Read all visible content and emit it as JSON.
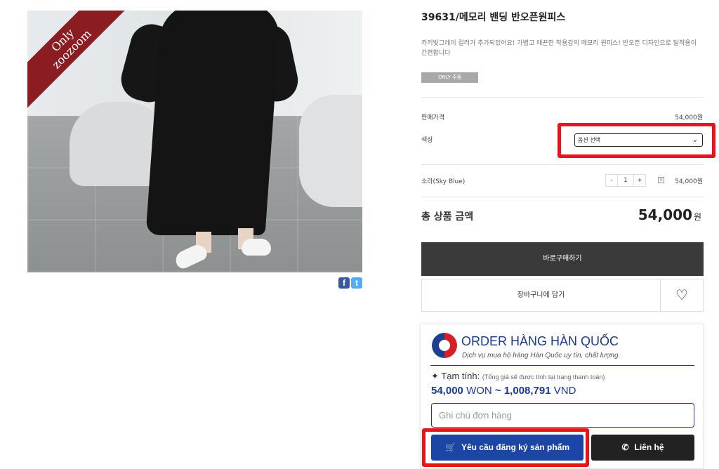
{
  "product": {
    "ribbon_line1": "Only",
    "ribbon_line2": "zoozoom",
    "title": "39631/메모리 밴딩 반오픈원피스",
    "description": "카키빛그레이 컬러가 추가되었어요! 가볍고 매끈한 착용감의 메모리 원피스! 반오픈 디자인으로 탈착용이 간편합니다",
    "tag": "ONLY 주줌"
  },
  "social": {
    "facebook": "f",
    "twitter": "t"
  },
  "pricing": {
    "price_label": "판매가격",
    "price_value": "54,000원",
    "color_label": "색상",
    "color_select_value": "옵션 선택"
  },
  "selected_option": {
    "name": "소라(Sky Blue)",
    "minus": "-",
    "qty": "1",
    "plus": "+",
    "remove": "×",
    "price": "54,000원"
  },
  "total": {
    "label": "총 상품 금액",
    "value": "54,000",
    "unit": "원"
  },
  "actions": {
    "buy_now": "바로구매하기",
    "add_to_cart": "장바구니에 담기",
    "wishlist_icon": "heart-icon"
  },
  "order_widget": {
    "title": "ORDER HÀNG HÀN QUỐC",
    "subtitle": "Dịch vụ mua hộ hàng Hàn Quốc uy tín, chất lượng.",
    "estimate_label": "Tạm tính:",
    "estimate_note": "(Tổng giá sẽ được tính tại trang thanh toán)",
    "price_won": "54,000",
    "won_unit": "WON",
    "tilde": "~",
    "price_vnd": "1,008,791",
    "vnd_unit": "VND",
    "note_placeholder": "Ghi chú đơn hàng",
    "register_button": "Yêu cầu đăng ký sản phẩm",
    "contact_button": "Liên hệ"
  },
  "colors": {
    "highlight": "#e8141c",
    "brand_blue": "#1b46a5",
    "dark_button": "#3a3a3a"
  }
}
